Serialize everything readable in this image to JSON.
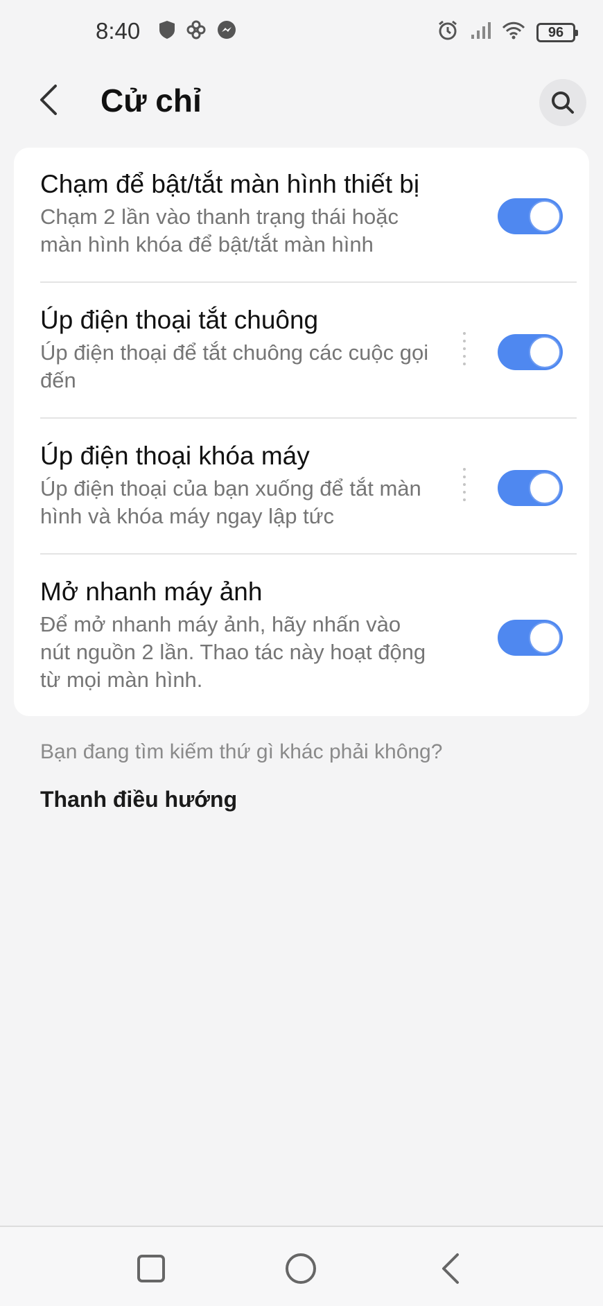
{
  "status_bar": {
    "time": "8:40",
    "left_icons": [
      "shield-icon",
      "pinwheel-icon",
      "messenger-icon"
    ],
    "right_icons": [
      "alarm-icon",
      "signal-icon",
      "wifi-icon"
    ],
    "battery": "96"
  },
  "app_bar": {
    "title": "Cử chỉ",
    "back_icon": "chevron-left-icon",
    "search_icon": "search-icon"
  },
  "settings": [
    {
      "title": "Chạm để bật/tắt màn hình thiết bị",
      "description": "Chạm 2 lần vào thanh trạng thái hoặc màn hình khóa để bật/tắt màn hình",
      "enabled": true
    },
    {
      "title": "Úp điện thoại tắt chuông",
      "description": "Úp điện thoại để tắt chuông các cuộc gọi đến",
      "enabled": true
    },
    {
      "title": "Úp điện thoại khóa máy",
      "description": "Úp điện thoại của bạn xuống để tắt màn hình và khóa máy ngay lập tức",
      "enabled": true
    },
    {
      "title": "Mở nhanh máy ảnh",
      "description": "Để mở nhanh máy ảnh, hãy nhấn vào nút nguồn 2 lần. Thao tác này hoạt động từ mọi màn hình.",
      "enabled": true
    }
  ],
  "suggestions": {
    "heading": "Bạn đang tìm kiếm thứ gì khác phải không?",
    "link": "Thanh điều hướng"
  },
  "nav_bar": {
    "icons": [
      "recents-square-icon",
      "home-circle-icon",
      "back-triangle-icon"
    ]
  },
  "colors": {
    "accent": "#4f88f0",
    "background": "#f4f4f5",
    "card": "#ffffff"
  }
}
